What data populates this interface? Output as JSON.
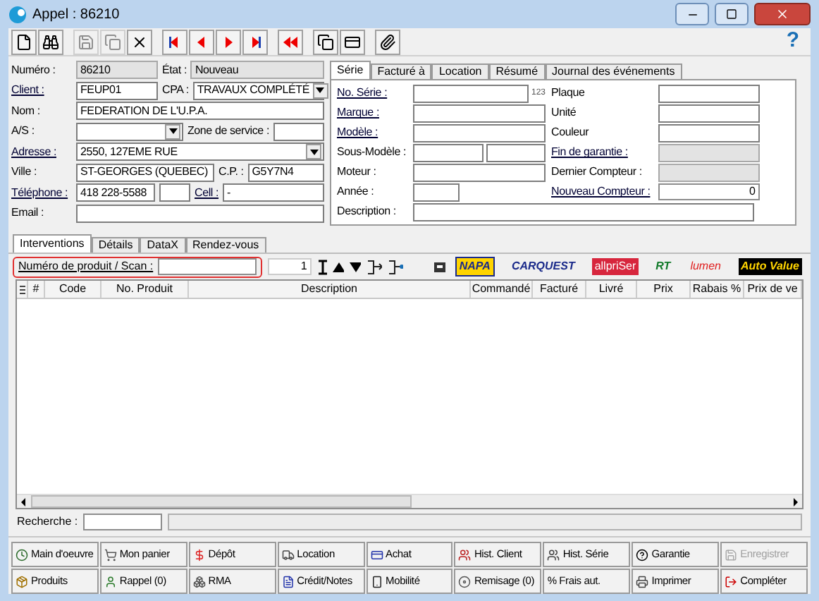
{
  "window": {
    "title": "Appel : 86210"
  },
  "toolbar": {
    "help": "?"
  },
  "client_form": {
    "rows": [
      [
        {
          "label": "Numéro :",
          "value": "86210",
          "link": false,
          "readonly": true,
          "dropdown": false
        },
        {
          "label": "État :",
          "value": "Nouveau",
          "link": false,
          "readonly": true,
          "dropdown": false
        }
      ],
      [
        {
          "label": "Client :",
          "value": "FEUP01",
          "link": true,
          "readonly": false,
          "dropdown": false
        },
        {
          "label": "CPA :",
          "value": "TRAVAUX COMPLÉTÉ",
          "link": false,
          "readonly": false,
          "dropdown": true
        }
      ],
      [
        {
          "label": "Nom :",
          "value": "FEDERATION DE L'U.P.A.",
          "link": false,
          "readonly": false,
          "dropdown": false
        }
      ],
      [
        {
          "label": "A/S :",
          "link": false,
          "readonly": false,
          "dropdown": true
        },
        {
          "label": "Zone de service :",
          "link": false,
          "readonly": false,
          "dropdown": false
        }
      ],
      [
        {
          "label": "Adresse :",
          "value": "2550, 127EME RUE",
          "link": true,
          "readonly": false,
          "dropdown": true
        }
      ],
      [
        {
          "label": "Ville :",
          "value": "ST-GEORGES (QUEBEC)",
          "link": false,
          "readonly": false,
          "dropdown": false
        },
        {
          "label": "C.P. :",
          "value": "G5Y7N4",
          "link": false,
          "readonly": false,
          "dropdown": false
        }
      ],
      [
        {
          "label": "Téléphone :",
          "value": "418 228-5588",
          "link": true,
          "readonly": false,
          "dropdown": false
        },
        {
          "readonly": false,
          "dropdown": false
        },
        {
          "label": "Cell :",
          "value": "-",
          "link": true,
          "readonly": false,
          "dropdown": false
        }
      ],
      [
        {
          "label": "Email :",
          "link": false,
          "readonly": false,
          "dropdown": false
        }
      ]
    ]
  },
  "detail_tabs": [
    {
      "label": "Série",
      "selected": true
    },
    {
      "label": "Facturé à",
      "selected": false
    },
    {
      "label": "Location",
      "selected": false
    },
    {
      "label": "Résumé",
      "selected": false
    },
    {
      "label": "Journal des événements",
      "selected": false
    }
  ],
  "serie_form": {
    "rows": [
      {
        "left": [
          {
            "label": "No. Série :",
            "link": true,
            "readonly": false,
            "suffix": "123"
          }
        ],
        "right": {
          "label": "Plaque",
          "link": false,
          "readonly": false
        }
      },
      {
        "left": [
          {
            "label": "Marque :",
            "link": true,
            "readonly": false
          }
        ],
        "right": {
          "label": "Unité",
          "link": false,
          "readonly": false
        }
      },
      {
        "left": [
          {
            "label": "Modèle :",
            "link": true,
            "readonly": false
          }
        ],
        "right": {
          "label": "Couleur",
          "link": false,
          "readonly": false
        }
      },
      {
        "left": [
          {
            "label": "Sous-Modèle :",
            "link": false,
            "readonly": false
          },
          {
            "readonly": false
          }
        ],
        "right": {
          "label": "Fin de garantie :",
          "link": true,
          "readonly": true
        }
      },
      {
        "left": [
          {
            "label": "Moteur :",
            "link": false,
            "readonly": false
          }
        ],
        "right": {
          "label": "Dernier Compteur :",
          "link": false,
          "readonly": true
        }
      },
      {
        "left": [
          {
            "label": "Année :",
            "link": false,
            "readonly": false
          }
        ],
        "right": {
          "label": "Nouveau Compteur :",
          "value": "0",
          "link": true,
          "readonly": false
        }
      },
      {
        "left": [
          {
            "label": "Description :",
            "link": false,
            "readonly": false
          }
        ]
      }
    ]
  },
  "lower_tabs": [
    {
      "label": "Interventions",
      "selected": true
    },
    {
      "label": "Détails",
      "selected": false
    },
    {
      "label": "DataX",
      "selected": false
    },
    {
      "label": "Rendez-vous",
      "selected": false
    }
  ],
  "scan": {
    "label": "Numéro de produit / Scan :",
    "quantity": "1",
    "highlighted": true
  },
  "suppliers": [
    {
      "label": "NAPA"
    },
    {
      "label": "CARQUEST"
    },
    {
      "label": "allpriSer"
    },
    {
      "label": "RT"
    },
    {
      "label": "lumen"
    },
    {
      "label": "Auto Value"
    }
  ],
  "table": {
    "columns": [
      "#",
      "Code",
      "No. Produit",
      "Description",
      "Commandé",
      "Facturé",
      "Livré",
      "Prix",
      "Rabais %",
      "Prix de ve"
    ]
  },
  "search": {
    "label": "Recherche :"
  },
  "actions": [
    {
      "label": "Main d'oeuvre",
      "disabled": false
    },
    {
      "label": "Mon panier",
      "disabled": false
    },
    {
      "label": "Dépôt",
      "disabled": false
    },
    {
      "label": "Location",
      "disabled": false
    },
    {
      "label": "Achat",
      "disabled": false
    },
    {
      "label": "Hist. Client",
      "disabled": false
    },
    {
      "label": "Hist. Série",
      "disabled": false
    },
    {
      "label": "Garantie",
      "disabled": false
    },
    {
      "label": "Enregistrer",
      "disabled": true
    },
    {
      "label": "Produits",
      "disabled": false
    },
    {
      "label": "Rappel (0)",
      "disabled": false
    },
    {
      "label": "RMA",
      "disabled": false
    },
    {
      "label": "Crédit/Notes",
      "disabled": false
    },
    {
      "label": "Mobilité",
      "disabled": false
    },
    {
      "label": "Remisage (0)",
      "disabled": false
    },
    {
      "label": "% Frais aut.",
      "disabled": false
    },
    {
      "label": "Imprimer",
      "disabled": false
    },
    {
      "label": "Compléter",
      "disabled": false
    }
  ]
}
